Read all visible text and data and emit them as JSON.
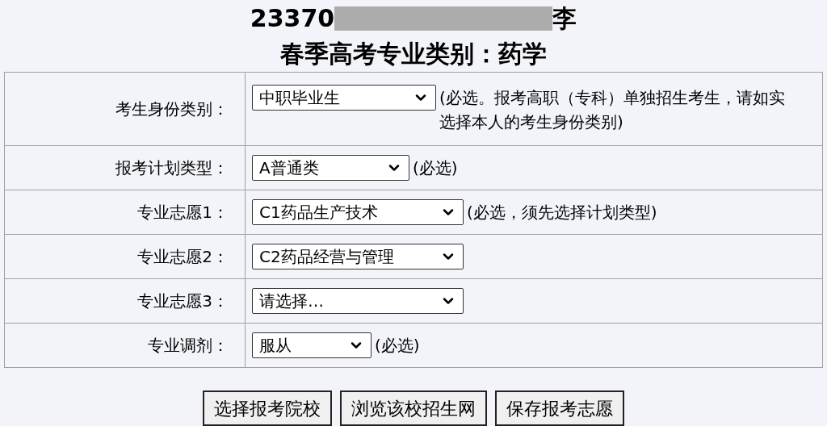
{
  "header": {
    "id_prefix": "23370",
    "name_suffix": "李",
    "subtitle": "春季高考专业类别：药学"
  },
  "form_rows": [
    {
      "label": "考生身份类别：",
      "value": "中职毕业生",
      "note": "(必选。报考高职（专科）单独招生考生，请如实选择本人的考生身份类别)"
    },
    {
      "label": "报考计划类型：",
      "value": "A普通类",
      "note": "(必选)"
    },
    {
      "label": "专业志愿1：",
      "value": "C1药品生产技术",
      "note": "(必选，须先选择计划类型)"
    },
    {
      "label": "专业志愿2：",
      "value": "C2药品经营与管理"
    },
    {
      "label": "专业志愿3：",
      "value": "请选择…"
    },
    {
      "label": "专业调剂：",
      "value": "服从",
      "note": "(必选)"
    }
  ],
  "buttons": [
    "选择报考院校",
    "浏览该校招生网",
    "保存报考志愿"
  ]
}
